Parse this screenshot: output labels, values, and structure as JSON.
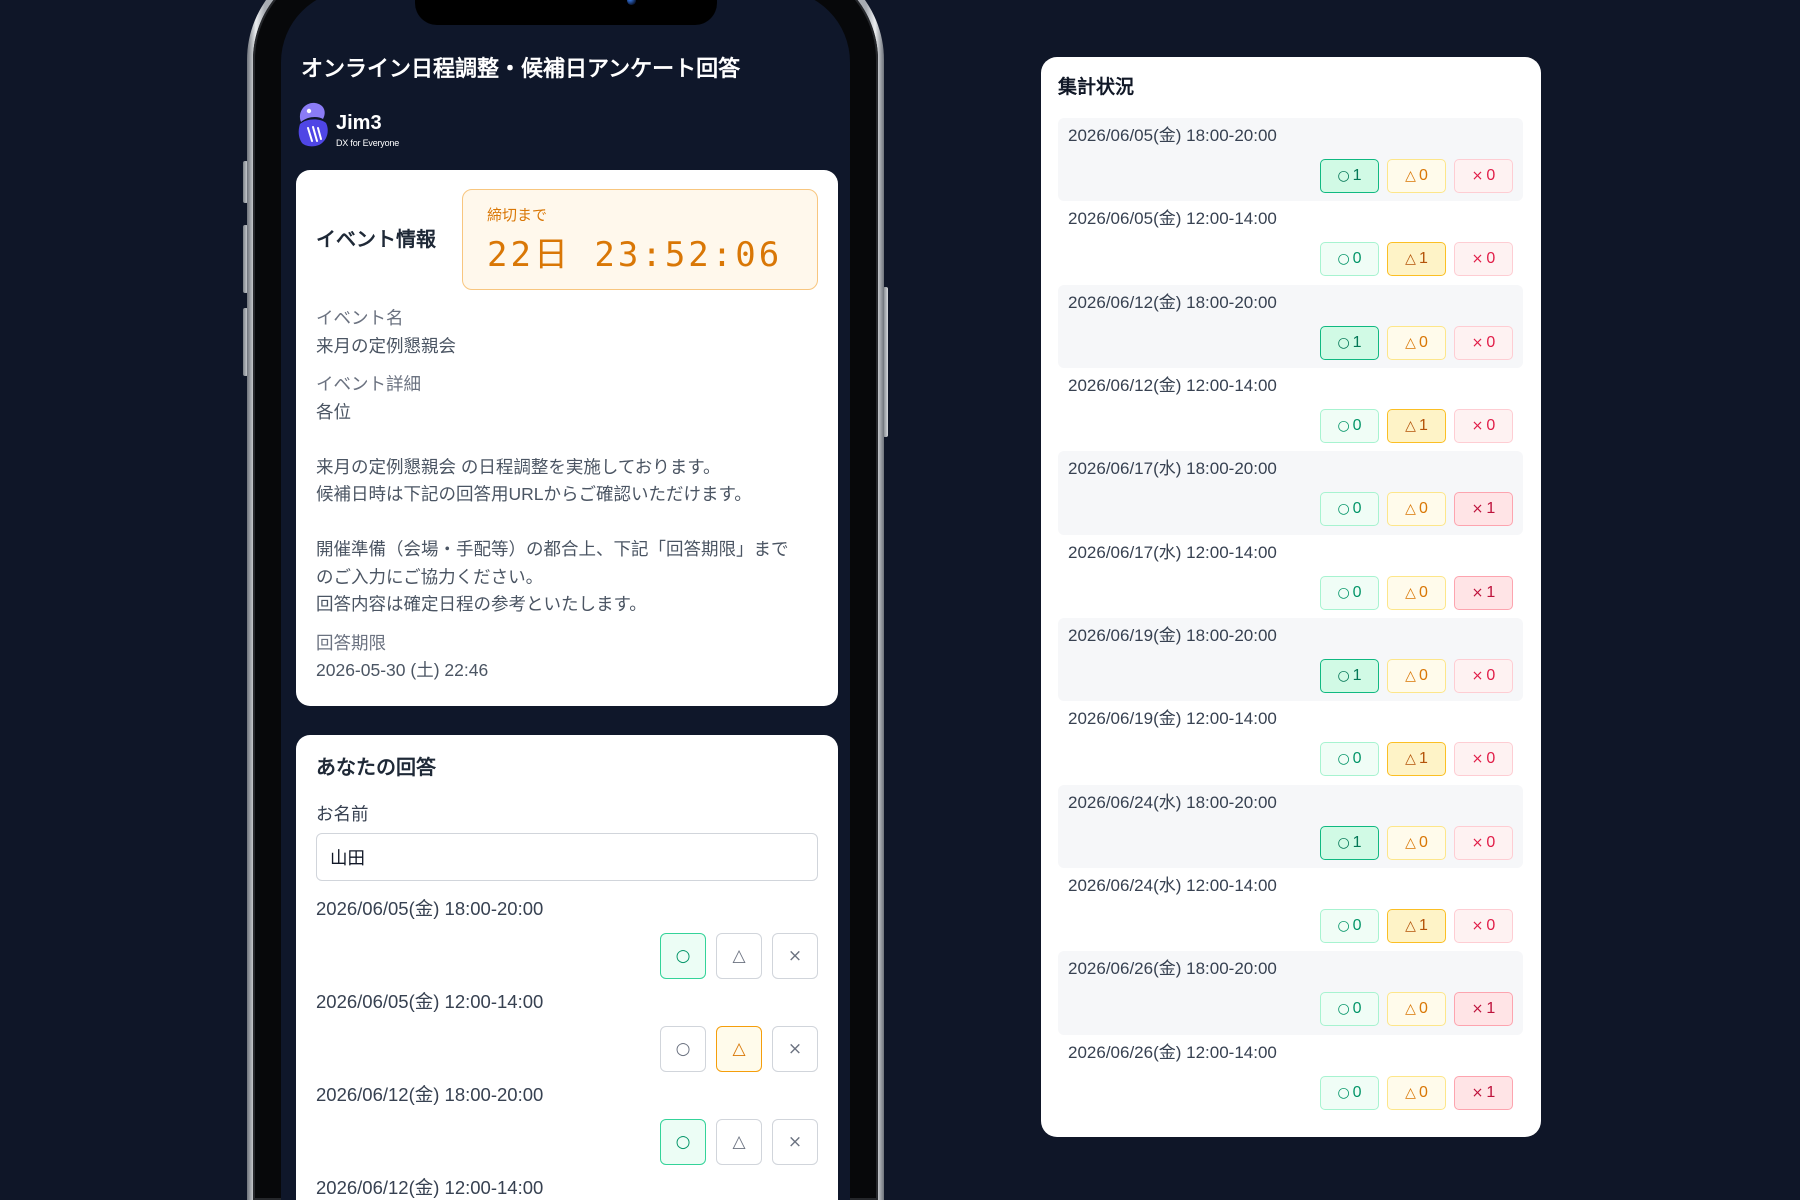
{
  "colors": {
    "page_background": "#0f1628",
    "screen_background": "#0f172a",
    "ok": "#10b981",
    "maybe": "#f59e0b",
    "ng": "#ef4444",
    "countdown": "#d97706"
  },
  "phone": {
    "title": "オンライン日程調整・候補日アンケート回答",
    "logo": {
      "icon": "jim3-mascot-icon",
      "name": "Jim3",
      "tagline": "DX for Everyone"
    },
    "event_card": {
      "heading": "イベント情報",
      "countdown": {
        "label": "締切まで",
        "value": "22日 23:52:06"
      },
      "fields": [
        {
          "label": "イベント名",
          "value": "来月の定例懇親会"
        },
        {
          "label": "イベント詳細",
          "value": "各位\n\n来月の定例懇親会 の日程調整を実施しております。\n候補日時は下記の回答用URLからご確認いただけます。\n\n開催準備（会場・手配等）の都合上、下記「回答期限」まで\nのご入力にご協力ください。\n回答内容は確定日程の参考といたします。"
        },
        {
          "label": "回答期限",
          "value": "2026-05-30 (土) 22:46"
        }
      ]
    },
    "answer_card": {
      "heading": "あなたの回答",
      "name_label": "お名前",
      "name_value": "山田",
      "choices": {
        "ok": "○",
        "maybe": "△",
        "ng": "×"
      },
      "slots": [
        {
          "date": "2026/06/05(金) 18:00-20:00",
          "selected": "ok"
        },
        {
          "date": "2026/06/05(金) 12:00-14:00",
          "selected": "maybe"
        },
        {
          "date": "2026/06/12(金) 18:00-20:00",
          "selected": "ok"
        },
        {
          "date": "2026/06/12(金) 12:00-14:00"
        }
      ]
    }
  },
  "summary": {
    "heading": "集計状況",
    "symbols": {
      "ok": "○",
      "maybe": "△",
      "ng": "×"
    },
    "rows": [
      {
        "date": "2026/06/05(金) 18:00-20:00",
        "ok": 1,
        "maybe": 0,
        "ng": 0
      },
      {
        "date": "2026/06/05(金) 12:00-14:00",
        "ok": 0,
        "maybe": 1,
        "ng": 0
      },
      {
        "date": "2026/06/12(金) 18:00-20:00",
        "ok": 1,
        "maybe": 0,
        "ng": 0
      },
      {
        "date": "2026/06/12(金) 12:00-14:00",
        "ok": 0,
        "maybe": 1,
        "ng": 0
      },
      {
        "date": "2026/06/17(水) 18:00-20:00",
        "ok": 0,
        "maybe": 0,
        "ng": 1
      },
      {
        "date": "2026/06/17(水) 12:00-14:00",
        "ok": 0,
        "maybe": 0,
        "ng": 1
      },
      {
        "date": "2026/06/19(金) 18:00-20:00",
        "ok": 1,
        "maybe": 0,
        "ng": 0
      },
      {
        "date": "2026/06/19(金) 12:00-14:00",
        "ok": 0,
        "maybe": 1,
        "ng": 0
      },
      {
        "date": "2026/06/24(水) 18:00-20:00",
        "ok": 1,
        "maybe": 0,
        "ng": 0
      },
      {
        "date": "2026/06/24(水) 12:00-14:00",
        "ok": 0,
        "maybe": 1,
        "ng": 0
      },
      {
        "date": "2026/06/26(金) 18:00-20:00",
        "ok": 0,
        "maybe": 0,
        "ng": 1
      },
      {
        "date": "2026/06/26(金) 12:00-14:00",
        "ok": 0,
        "maybe": 0,
        "ng": 1
      }
    ]
  }
}
